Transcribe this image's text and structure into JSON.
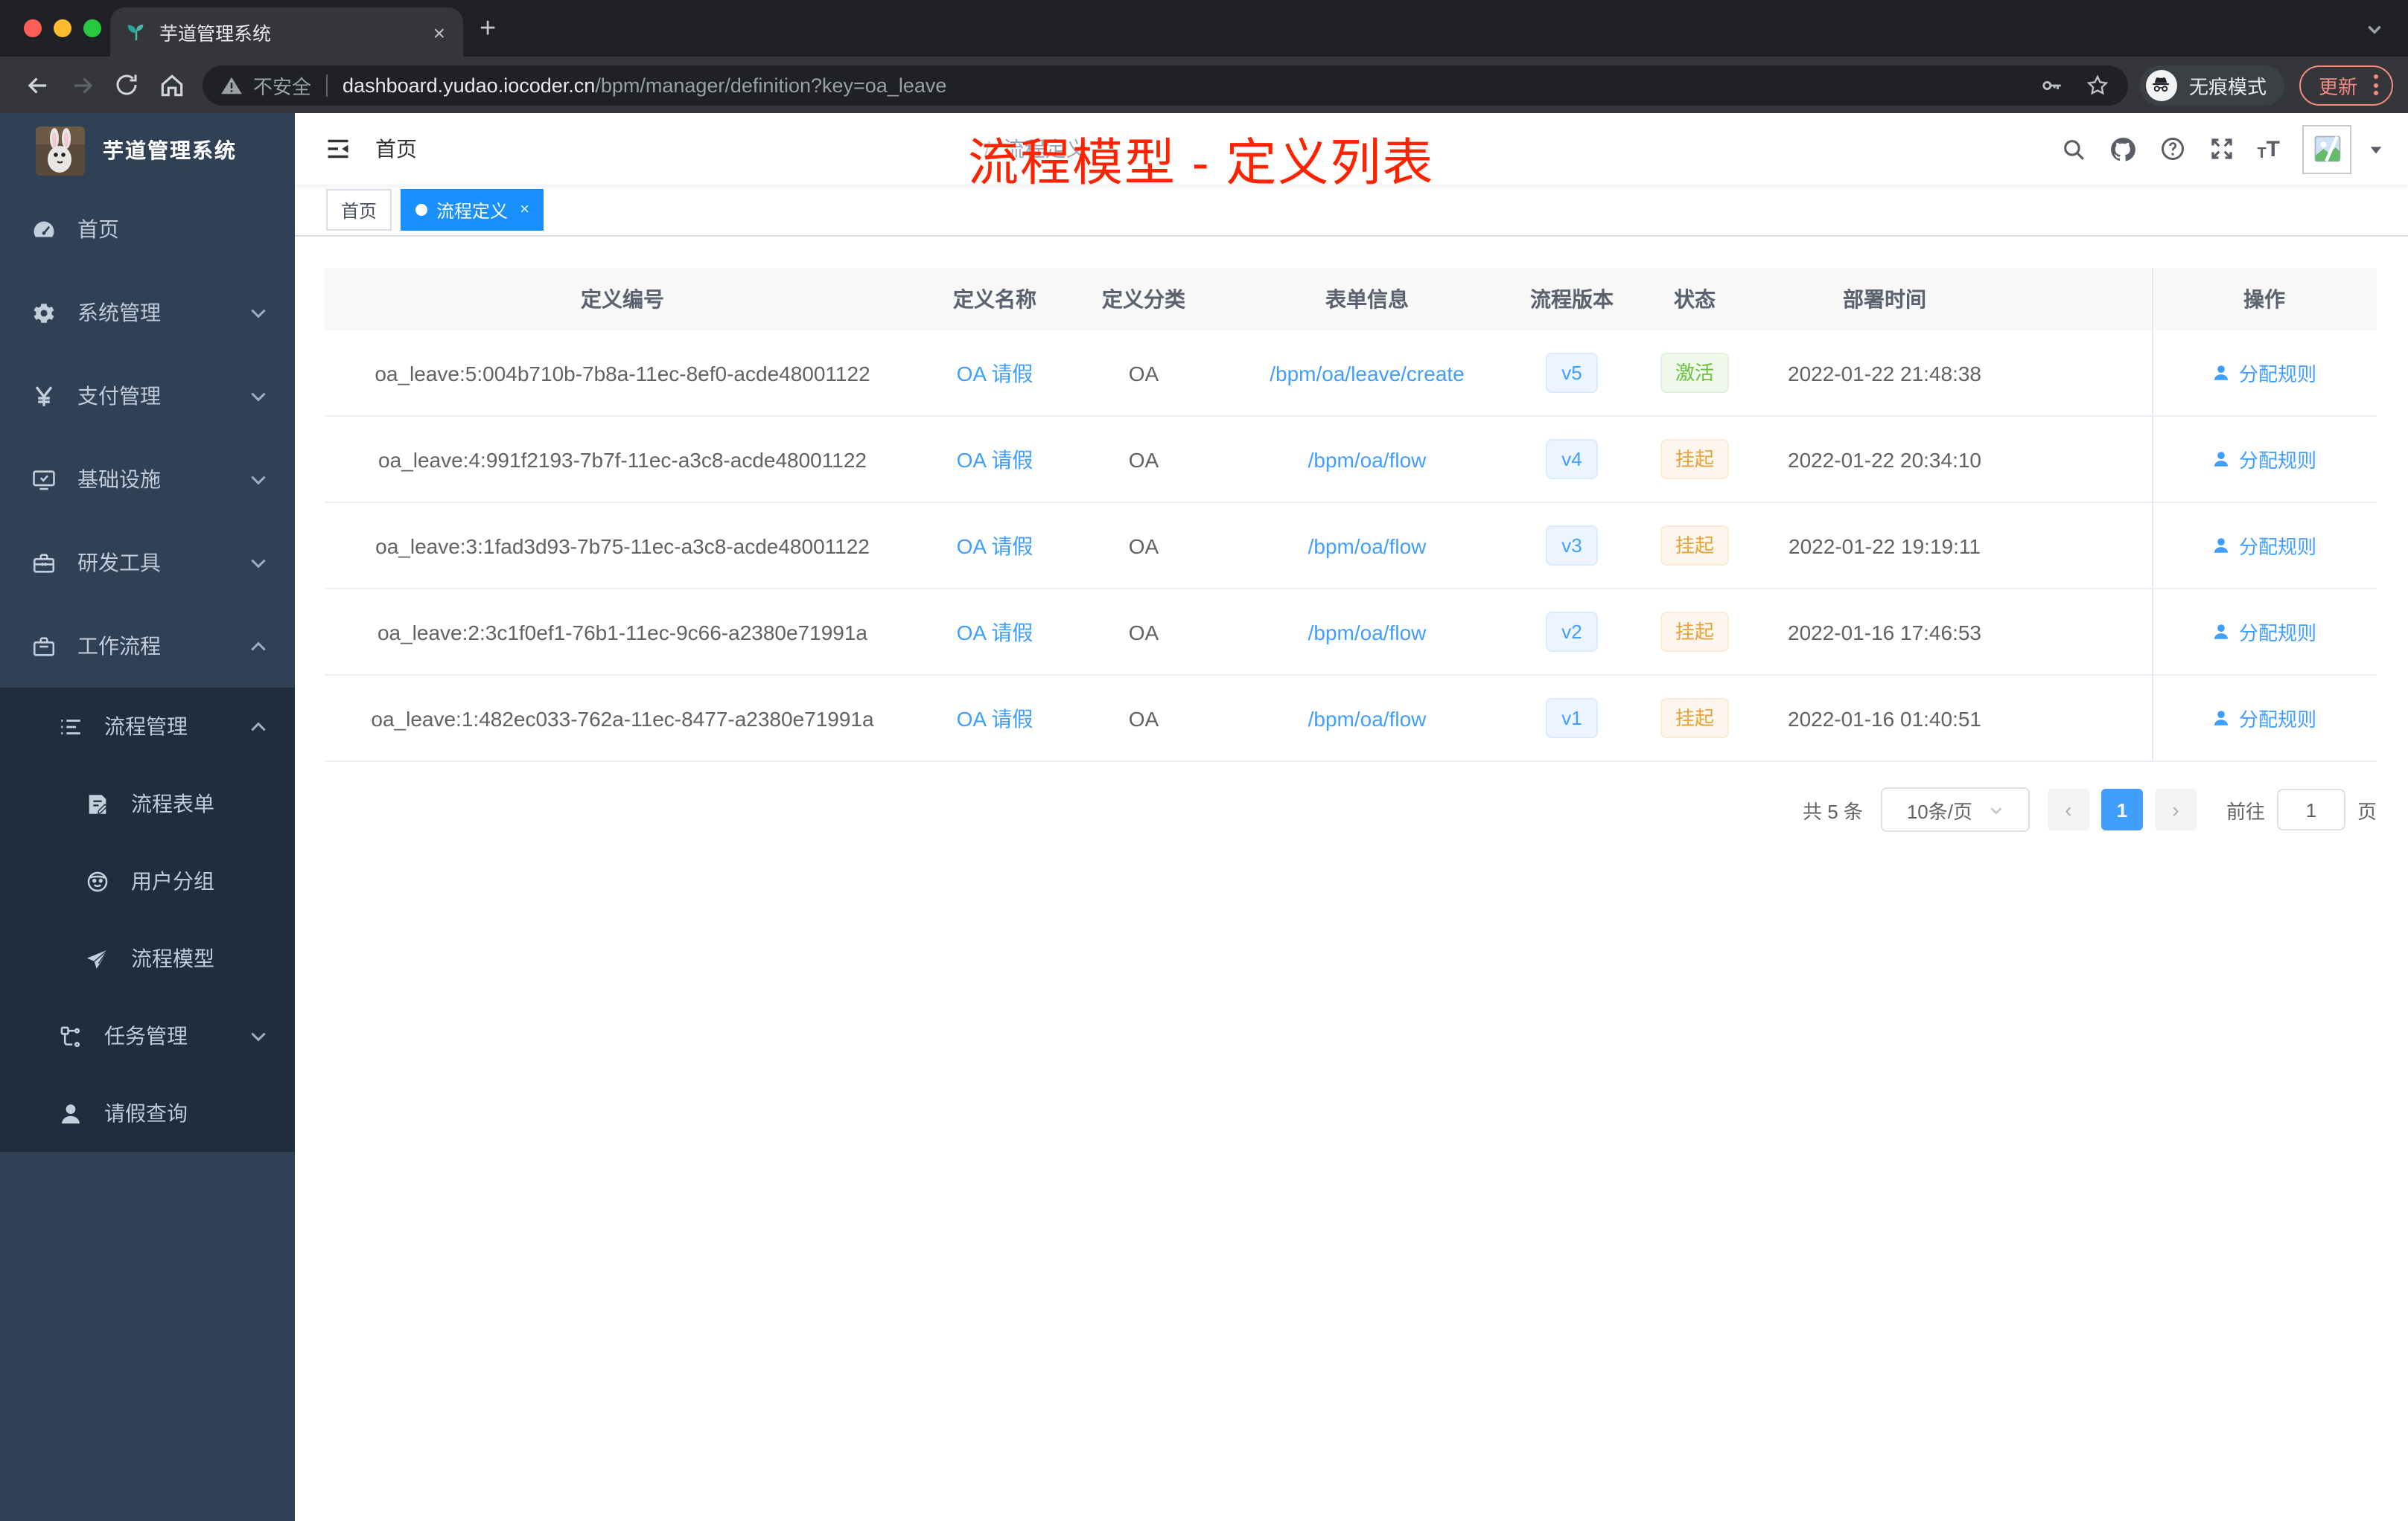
{
  "browser": {
    "tab": {
      "title": "芋道管理系统",
      "close": "×",
      "new_tab": "+"
    },
    "url": {
      "security": "不安全",
      "host": "dashboard.yudao.iocoder.cn",
      "path": "/bpm/manager/definition?key=oa_leave"
    },
    "incognito_label": "无痕模式",
    "update_label": "更新"
  },
  "sidebar": {
    "title": "芋道管理系统",
    "bg": "#304156",
    "submenu_bg": "#1f2d3d",
    "items": [
      {
        "name": "home",
        "icon": "dashboard-icon",
        "label": "首页",
        "level": 1
      },
      {
        "name": "system-management",
        "icon": "gear-icon",
        "label": "系统管理",
        "level": 1,
        "chevron": "down"
      },
      {
        "name": "payment-management",
        "icon": "yen-icon",
        "label": "支付管理",
        "level": 1,
        "chevron": "down"
      },
      {
        "name": "infrastructure",
        "icon": "monitor-icon",
        "label": "基础设施",
        "level": 1,
        "chevron": "down"
      },
      {
        "name": "dev-tools",
        "icon": "toolbox-icon",
        "label": "研发工具",
        "level": 1,
        "chevron": "down"
      },
      {
        "name": "workflow",
        "icon": "briefcase-icon",
        "label": "工作流程",
        "level": 1,
        "chevron": "up"
      },
      {
        "name": "process-management",
        "icon": "list-icon",
        "label": "流程管理",
        "level": 2,
        "chevron": "up",
        "dark": true
      },
      {
        "name": "process-form",
        "icon": "form-icon",
        "label": "流程表单",
        "level": 3,
        "dark": true
      },
      {
        "name": "user-group",
        "icon": "people-icon",
        "label": "用户分组",
        "level": 3,
        "dark": true
      },
      {
        "name": "process-model",
        "icon": "send-icon",
        "label": "流程模型",
        "level": 3,
        "dark": true
      },
      {
        "name": "task-management",
        "icon": "tree-icon",
        "label": "任务管理",
        "level": 2,
        "chevron": "down",
        "dark": true
      },
      {
        "name": "leave-query",
        "icon": "user-icon",
        "label": "请假查询",
        "level": 2,
        "dark": true
      }
    ]
  },
  "header": {
    "breadcrumb": [
      "首页",
      "流程定义"
    ],
    "separator": "/"
  },
  "tags": [
    {
      "label": "首页",
      "active": false
    },
    {
      "label": "流程定义",
      "active": true,
      "closable": true
    }
  ],
  "annotation": {
    "text": "流程模型 - 定义列表",
    "color": "#ff2200"
  },
  "table": {
    "columns": [
      "定义编号",
      "定义名称",
      "定义分类",
      "表单信息",
      "流程版本",
      "状态",
      "部署时间",
      "操作"
    ],
    "accent": "#409eff",
    "rows": [
      {
        "id": "oa_leave:5:004b710b-7b8a-11ec-8ef0-acde48001122",
        "name": "OA 请假",
        "category": "OA",
        "form": "/bpm/oa/leave/create",
        "version": "v5",
        "status": "激活",
        "status_type": "success",
        "time": "2022-01-22 21:48:38",
        "action": "分配规则"
      },
      {
        "id": "oa_leave:4:991f2193-7b7f-11ec-a3c8-acde48001122",
        "name": "OA 请假",
        "category": "OA",
        "form": "/bpm/oa/flow",
        "version": "v4",
        "status": "挂起",
        "status_type": "warning",
        "time": "2022-01-22 20:34:10",
        "action": "分配规则"
      },
      {
        "id": "oa_leave:3:1fad3d93-7b75-11ec-a3c8-acde48001122",
        "name": "OA 请假",
        "category": "OA",
        "form": "/bpm/oa/flow",
        "version": "v3",
        "status": "挂起",
        "status_type": "warning",
        "time": "2022-01-22 19:19:11",
        "action": "分配规则"
      },
      {
        "id": "oa_leave:2:3c1f0ef1-76b1-11ec-9c66-a2380e71991a",
        "name": "OA 请假",
        "category": "OA",
        "form": "/bpm/oa/flow",
        "version": "v2",
        "status": "挂起",
        "status_type": "warning",
        "time": "2022-01-16 17:46:53",
        "action": "分配规则"
      },
      {
        "id": "oa_leave:1:482ec033-762a-11ec-8477-a2380e71991a",
        "name": "OA 请假",
        "category": "OA",
        "form": "/bpm/oa/flow",
        "version": "v1",
        "status": "挂起",
        "status_type": "warning",
        "time": "2022-01-16 01:40:51",
        "action": "分配规则"
      }
    ]
  },
  "pagination": {
    "total": "共 5 条",
    "size": "10条/页",
    "prev": "‹",
    "current": "1",
    "next": "›",
    "goto_label": "前往",
    "goto_value": "1",
    "unit": "页"
  },
  "colors": {
    "success": "#67c23a",
    "warning": "#e6a23c",
    "accent": "#409eff"
  }
}
